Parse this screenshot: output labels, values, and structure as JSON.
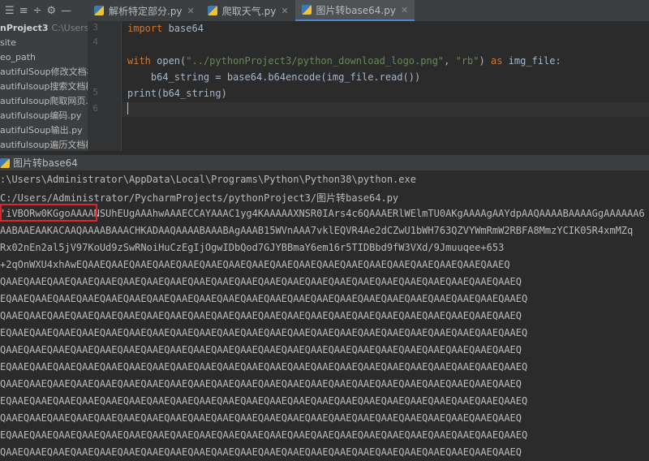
{
  "toolbar": {
    "icons": [
      "list-icon",
      "align-icon",
      "divide-icon",
      "gear-icon",
      "minus-icon"
    ]
  },
  "tabs": [
    {
      "label": "解析特定部分.py",
      "active": false
    },
    {
      "label": "爬取天气.py",
      "active": false
    },
    {
      "label": "图片转base64.py",
      "active": true
    }
  ],
  "project": {
    "root": "nProject3",
    "root_path": "C:\\Users\\",
    "items": [
      "site",
      "eo_path",
      "autifulSoup修改文档树",
      "autifulsoup搜索文档树",
      "autifulsoup爬取网页.p",
      "autifulsoup编码.py",
      "autifulSoup输出.py",
      "autifulsoup遍历文档树"
    ]
  },
  "editor": {
    "line_numbers": [
      "3",
      "4",
      "5",
      "6"
    ],
    "lines": {
      "l1_kw": "import",
      "l1_rest": " base64",
      "l2_kw": "with",
      "l2_a": " open(",
      "l2_str1": "\"../pythonProject3/python_download_logo.png\"",
      "l2_b": ", ",
      "l2_str2": "\"rb\"",
      "l2_c": ") ",
      "l2_kw2": "as",
      "l2_d": " img_file:",
      "l3": "    b64_string = base64.b64encode(img_file.read())",
      "l4_fn": "print",
      "l4_rest": "(b64_string)"
    }
  },
  "run": {
    "title": "图片转base64"
  },
  "console": {
    "lines": [
      ":\\Users\\Administrator\\AppData\\Local\\Programs\\Python\\Python38\\python.exe",
      "C:/Users/Administrator/PycharmProjects/pythonProject3/图片转base64.py",
      "'iVBORw0KGgoAAAANSUhEUgAAAhwAAAECCAYAAAC1yg4KAAAAAXNSR0IArs4c6QAAAERlWElmTU0AKgAAAAgAAYdpAAQAAAABAAAAGgAAAAAA6",
      "AABAAEAAKACAAQAAAABAAACHKADAAQAAAABAAABAgAAAB15WVnAAA7vklEQVR4Ae2dCZwU1bWH763QZVYWmRmW2RBFA8MmzYCIK05R4xmMZq",
      "Rx02nEn2al5jV97KoUd9zSwRNoiHuCzEgIjOgwIDbQod7GJYBBmaY6em16r5TIDBbd9fW3VXd/9Jmuuqee+653",
      "+2qOnWXU4xhAwEQAAEQAAEQAAEQAAEQAAEQAAEQAAEQAAEQAAEQAAEQAAEQAAEQAAEQAAEQAAEQAAEQAAEQAAEQ",
      "QAAEQAAEQAAEQAAEQAAEQAAEQAAEQAAEQAAEQAAEQAAEQAAEQAAEQAAEQAAEQAAEQAAEQAAEQAAEQAAEQAAEQAAEQ",
      "EQAAEQAAEQAAEQAAEQAAEQAAEQAAEQAAEQAAEQAAEQAAEQAAEQAAEQAAEQAAEQAAEQAAEQAAEQAAEQAAEQAAEQAAEQ",
      "QAAEQAAEQAAEQAAEQAAEQAAEQAAEQAAEQAAEQAAEQAAEQAAEQAAEQAAEQAAEQAAEQAAEQAAEQAAEQAAEQAAEQAAEQ",
      "EQAAEQAAEQAAEQAAEQAAEQAAEQAAEQAAEQAAEQAAEQAAEQAAEQAAEQAAEQAAEQAAEQAAEQAAEQAAEQAAEQAAEQAAEQ",
      "QAAEQAAEQAAEQAAEQAAEQAAEQAAEQAAEQAAEQAAEQAAEQAAEQAAEQAAEQAAEQAAEQAAEQAAEQAAEQAAEQAAEQAAEQ",
      "EQAAEQAAEQAAEQAAEQAAEQAAEQAAEQAAEQAAEQAAEQAAEQAAEQAAEQAAEQAAEQAAEQAAEQAAEQAAEQAAEQAAEQAAEQ",
      "QAAEQAAEQAAEQAAEQAAEQAAEQAAEQAAEQAAEQAAEQAAEQAAEQAAEQAAEQAAEQAAEQAAEQAAEQAAEQAAEQAAEQAAEQ",
      "EQAAEQAAEQAAEQAAEQAAEQAAEQAAEQAAEQAAEQAAEQAAEQAAEQAAEQAAEQAAEQAAEQAAEQAAEQAAEQAAEQAAEQAAEQ",
      "QAAEQAAEQAAEQAAEQAAEQAAEQAAEQAAEQAAEQAAEQAAEQAAEQAAEQAAEQAAEQAAEQAAEQAAEQAAEQAAEQAAEQAAEQ",
      "EQAAEQAAEQAAEQAAEQAAEQAAEQAAEQAAEQAAEQAAEQAAEQAAEQAAEQAAEQAAEQAAEQAAEQAAEQAAEQAAEQAAEQAAEQ",
      "QAAEQAAEQAAEQAAEQAAEQAAEQAAEQAAEQAAEQAAEQAAEQAAEQAAEQAAEQAAEQAAEQAAEQAAEQAAEQAAEQAAEQAAEQ"
    ]
  },
  "colors": {
    "accent": "#4a88c7",
    "highlight": "#e0262b"
  }
}
